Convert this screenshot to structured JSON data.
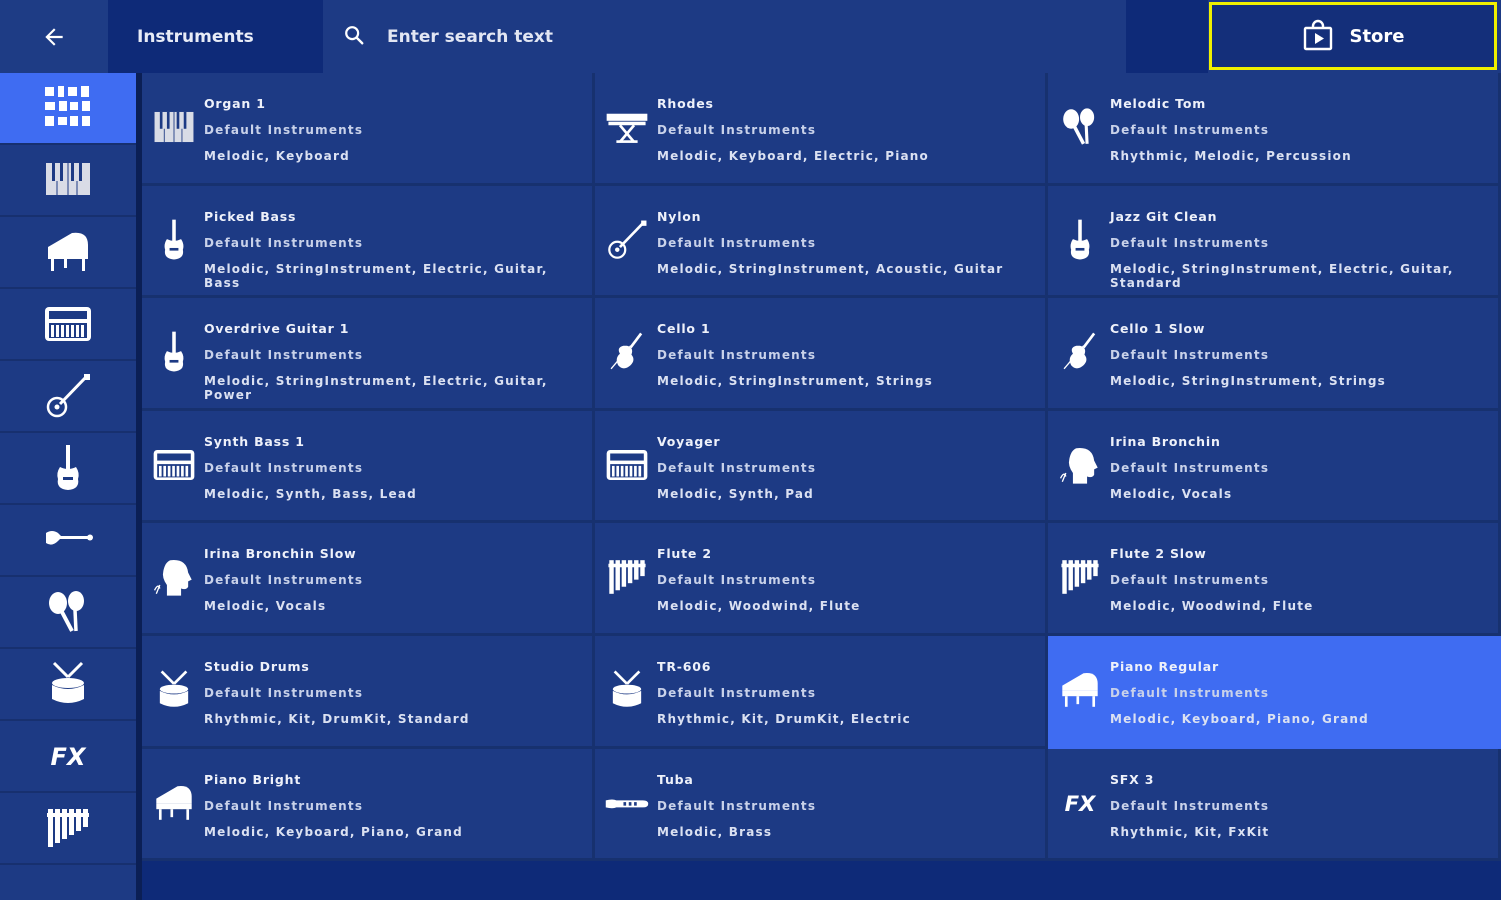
{
  "header": {
    "title": "Instruments",
    "search_placeholder": "Enter search text",
    "search_value": "",
    "store_label": "Store"
  },
  "sidebar": {
    "categories": [
      {
        "icon": "all-instruments-icon",
        "active": true
      },
      {
        "icon": "keyboard-icon",
        "active": false
      },
      {
        "icon": "grand-piano-icon",
        "active": false
      },
      {
        "icon": "synth-icon",
        "active": false
      },
      {
        "icon": "acoustic-guitar-icon",
        "active": false
      },
      {
        "icon": "electric-guitar-icon",
        "active": false
      },
      {
        "icon": "bass-guitar-icon",
        "active": false
      },
      {
        "icon": "maracas-icon",
        "active": false
      },
      {
        "icon": "drum-icon",
        "active": false
      },
      {
        "icon": "fx-icon",
        "active": false
      },
      {
        "icon": "flute-icon",
        "active": false
      }
    ]
  },
  "instruments": [
    {
      "name": "Organ 1",
      "library": "Default Instruments",
      "tags": "Melodic, Keyboard",
      "icon": "keyboard-icon"
    },
    {
      "name": "Rhodes",
      "library": "Default Instruments",
      "tags": "Melodic, Keyboard, Electric, Piano",
      "icon": "rhodes-icon"
    },
    {
      "name": "Melodic Tom",
      "library": "Default Instruments",
      "tags": "Rhythmic, Melodic, Percussion",
      "icon": "maracas-icon"
    },
    {
      "name": "Picked Bass",
      "library": "Default Instruments",
      "tags": "Melodic, StringInstrument, Electric, Guitar, Bass",
      "icon": "electric-guitar-icon"
    },
    {
      "name": "Nylon",
      "library": "Default Instruments",
      "tags": "Melodic, StringInstrument, Acoustic, Guitar",
      "icon": "acoustic-guitar-icon"
    },
    {
      "name": "Jazz Git Clean",
      "library": "Default Instruments",
      "tags": "Melodic, StringInstrument, Electric, Guitar, Standard",
      "icon": "electric-guitar-icon"
    },
    {
      "name": "Overdrive Guitar 1",
      "library": "Default Instruments",
      "tags": "Melodic, StringInstrument, Electric, Guitar, Power",
      "icon": "electric-guitar-icon"
    },
    {
      "name": "Cello 1",
      "library": "Default Instruments",
      "tags": "Melodic, StringInstrument, Strings",
      "icon": "violin-icon"
    },
    {
      "name": "Cello 1 Slow",
      "library": "Default Instruments",
      "tags": "Melodic, StringInstrument, Strings",
      "icon": "violin-icon"
    },
    {
      "name": "Synth Bass 1",
      "library": "Default Instruments",
      "tags": "Melodic, Synth, Bass, Lead",
      "icon": "synth-icon"
    },
    {
      "name": "Voyager",
      "library": "Default Instruments",
      "tags": "Melodic, Synth, Pad",
      "icon": "synth-icon"
    },
    {
      "name": "Irina Bronchin",
      "library": "Default Instruments",
      "tags": "Melodic, Vocals",
      "icon": "vocal-head-icon"
    },
    {
      "name": "Irina Bronchin Slow",
      "library": "Default Instruments",
      "tags": "Melodic, Vocals",
      "icon": "vocal-head-icon"
    },
    {
      "name": "Flute 2",
      "library": "Default Instruments",
      "tags": "Melodic, Woodwind, Flute",
      "icon": "flute-icon"
    },
    {
      "name": "Flute 2 Slow",
      "library": "Default Instruments",
      "tags": "Melodic, Woodwind, Flute",
      "icon": "flute-icon"
    },
    {
      "name": "Studio Drums",
      "library": "Default Instruments",
      "tags": "Rhythmic, Kit, DrumKit, Standard",
      "icon": "drum-icon"
    },
    {
      "name": "TR-606",
      "library": "Default Instruments",
      "tags": "Rhythmic, Kit, DrumKit, Electric",
      "icon": "drum-icon"
    },
    {
      "name": "Piano Regular",
      "library": "Default Instruments",
      "tags": "Melodic, Keyboard, Piano, Grand",
      "icon": "grand-piano-icon",
      "selected": true
    },
    {
      "name": "Piano Bright",
      "library": "Default Instruments",
      "tags": "Melodic, Keyboard, Piano, Grand",
      "icon": "grand-piano-icon"
    },
    {
      "name": "Tuba",
      "library": "Default Instruments",
      "tags": "Melodic, Brass",
      "icon": "tuba-icon"
    },
    {
      "name": "SFX 3",
      "library": "Default Instruments",
      "tags": "Rhythmic, Kit, FxKit",
      "icon": "fx-icon"
    }
  ],
  "colors": {
    "background": "#1d3a84",
    "header_dark": "#0e2a78",
    "selected": "#3f6cf2",
    "store_outline": "#f0f000"
  }
}
